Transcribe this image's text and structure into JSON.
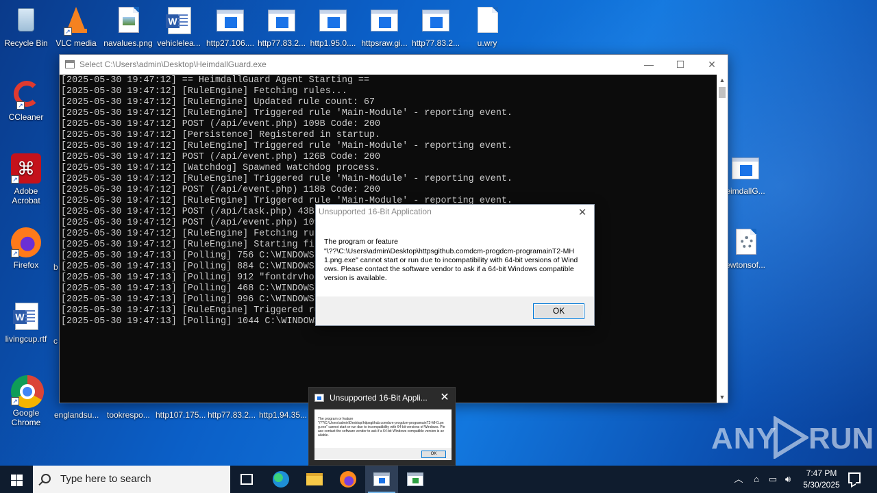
{
  "desktop": {
    "top_icons": [
      {
        "label": "Recycle Bin",
        "icon": "recycle-bin-icon"
      },
      {
        "label": "VLC media",
        "icon": "vlc-icon"
      },
      {
        "label": "navalues.png",
        "icon": "image-file-icon"
      },
      {
        "label": "vehiclelea...",
        "icon": "word-doc-icon"
      },
      {
        "label": "http27.106....",
        "icon": "app-window-icon"
      },
      {
        "label": "http77.83.2...",
        "icon": "app-window-icon"
      },
      {
        "label": "http1.95.0....",
        "icon": "app-window-icon"
      },
      {
        "label": "httpsraw.gi...",
        "icon": "app-window-icon"
      },
      {
        "label": "http77.83.2...",
        "icon": "app-window-icon"
      },
      {
        "label": "u.wry",
        "icon": "blank-file-icon"
      }
    ],
    "left_icons": [
      {
        "label": "CCleaner",
        "icon": "ccleaner-icon"
      },
      {
        "label": "Adobe Acrobat",
        "icon": "acrobat-icon"
      },
      {
        "label": "Firefox",
        "icon": "firefox-icon"
      },
      {
        "label": "livingcup.rtf",
        "icon": "word-doc-icon"
      },
      {
        "label": "Google Chrome",
        "icon": "chrome-icon"
      }
    ],
    "right_icons": [
      {
        "label": "eimdallG...",
        "icon": "app-window-icon"
      },
      {
        "label": "ewtonsof...",
        "icon": "settings-file-icon"
      }
    ],
    "bottom_row_labels": [
      "englandsu...",
      "tookrespo...",
      "http107.175...",
      "http77.83.2...",
      "http1.94.35..."
    ],
    "partial_left_letters": [
      "b",
      "c"
    ]
  },
  "console_window": {
    "title": "Select C:\\Users\\admin\\Desktop\\HeimdallGuard.exe",
    "minimize_glyph": "—",
    "maximize_glyph": "☐",
    "close_glyph": "✕",
    "lines": [
      "[2025-05-30 19:47:12] == HeimdallGuard Agent Starting ==",
      "[2025-05-30 19:47:12] [RuleEngine] Fetching rules...",
      "[2025-05-30 19:47:12] [RuleEngine] Updated rule count: 67",
      "[2025-05-30 19:47:12] [RuleEngine] Triggered rule 'Main-Module' - reporting event.",
      "[2025-05-30 19:47:12] POST (/api/event.php) 109B Code: 200",
      "[2025-05-30 19:47:12] [Persistence] Registered in startup.",
      "[2025-05-30 19:47:12] [RuleEngine] Triggered rule 'Main-Module' - reporting event.",
      "[2025-05-30 19:47:12] POST (/api/event.php) 126B Code: 200",
      "[2025-05-30 19:47:12] [Watchdog] Spawned watchdog process.",
      "[2025-05-30 19:47:12] [RuleEngine] Triggered rule 'Main-Module' - reporting event.",
      "[2025-05-30 19:47:12] POST (/api/event.php) 118B Code: 200",
      "[2025-05-30 19:47:12] [RuleEngine] Triggered rule 'Main-Module' - reporting event.",
      "[2025-05-30 19:47:12] POST (/api/task.php) 43B",
      "[2025-05-30 19:47:12] POST (/api/event.php) 109",
      "[2025-05-30 19:47:12] [RuleEngine] Fetching rul",
      "[2025-05-30 19:47:12] [RuleEngine] Starting fil",
      "[2025-05-30 19:47:13] [Polling] 756 C:\\WINDOWS\\",
      "[2025-05-30 19:47:13] [Polling] 884 C:\\WINDOWS\\",
      "[2025-05-30 19:47:13] [Polling] 912 \"fontdrvhos",
      "[2025-05-30 19:47:13] [Polling] 468 C:\\WINDOWS\\",
      "[2025-05-30 19:47:13] [Polling] 996 C:\\WINDOWS\\",
      "[2025-05-30 19:47:13] [RuleEngine] Triggered ru",
      "[2025-05-30 19:47:13] [Polling] 1044 C:\\WINDOWS"
    ]
  },
  "dialog": {
    "title": "Unsupported 16-Bit Application",
    "message_intro": "The program or feature",
    "message_body": "\"\\??\\C:\\Users\\admin\\Desktop\\httpsgithub.comdcm-progdcm-programainT2-MH1.png.exe\" cannot start or run due to incompatibility with 64-bit versions of Windows. Please contact the software vendor to ask if a 64-bit Windows compatible version is available.",
    "ok_label": "OK",
    "close_glyph": "✕"
  },
  "taskbar_preview": {
    "title": "Unsupported 16-Bit Appli...",
    "close_glyph": "✕"
  },
  "watermark": {
    "left": "ANY",
    "right": "RUN"
  },
  "taskbar": {
    "search_placeholder": "Type here to search",
    "tray_chevron": "︿",
    "time": "7:47 PM",
    "date": "5/30/2025"
  }
}
